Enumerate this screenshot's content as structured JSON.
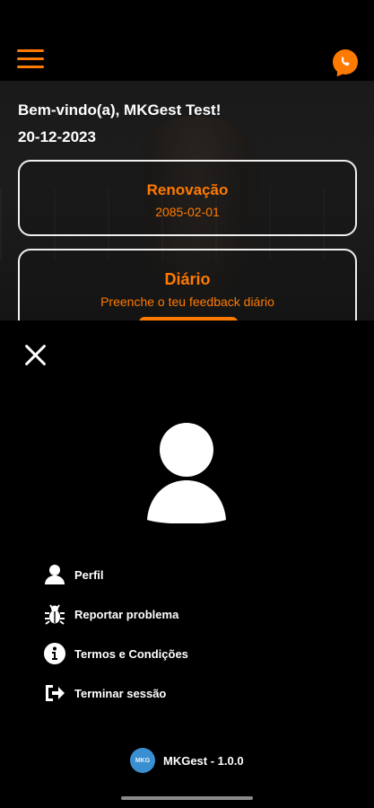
{
  "header": {
    "menu_icon": "hamburger-menu-icon",
    "contact_icon": "whatsapp-icon"
  },
  "home": {
    "welcome": "Bem-vindo(a), MKGest Test!",
    "date": "20-12-2023",
    "cards": [
      {
        "title": "Renovação",
        "subtitle": "2085-02-01"
      },
      {
        "title": "Diário",
        "subtitle": "Preenche o teu feedback diário"
      }
    ]
  },
  "drawer": {
    "close_icon": "close-icon",
    "avatar_icon": "user-avatar-icon",
    "menu": [
      {
        "label": "Perfil",
        "icon": "user-icon"
      },
      {
        "label": "Reportar problema",
        "icon": "bug-icon"
      },
      {
        "label": "Termos e Condições",
        "icon": "info-icon"
      },
      {
        "label": "Terminar sessão",
        "icon": "logout-icon"
      }
    ],
    "footer": {
      "logo_text": "MKG",
      "version": "MKGest - 1.0.0"
    }
  },
  "colors": {
    "accent": "#ff7a00",
    "background": "#000000",
    "text": "#ffffff",
    "logo": "#3a8fd0"
  }
}
